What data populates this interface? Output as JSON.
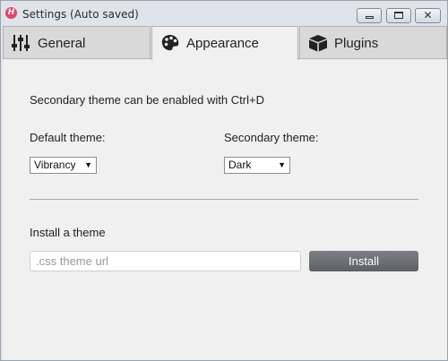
{
  "window": {
    "title": "Settings (Auto saved)",
    "buttons": {
      "minimize": "",
      "maximize": "",
      "close": "✕"
    }
  },
  "tabs": [
    {
      "label": "General",
      "icon": "sliders-icon",
      "active": false
    },
    {
      "label": "Appearance",
      "icon": "palette-icon",
      "active": true
    },
    {
      "label": "Plugins",
      "icon": "cube-icon",
      "active": false
    }
  ],
  "appearance": {
    "hint": "Secondary theme can be enabled with Ctrl+D",
    "default_theme_label": "Default theme:",
    "default_theme_value": "Vibrancy",
    "secondary_theme_label": "Secondary theme:",
    "secondary_theme_value": "Dark",
    "install_label": "Install a theme",
    "url_placeholder": ".css theme url",
    "url_value": "",
    "install_button": "Install"
  },
  "colors": {
    "app_icon": "#e2456a",
    "install_button": "#66696e"
  }
}
